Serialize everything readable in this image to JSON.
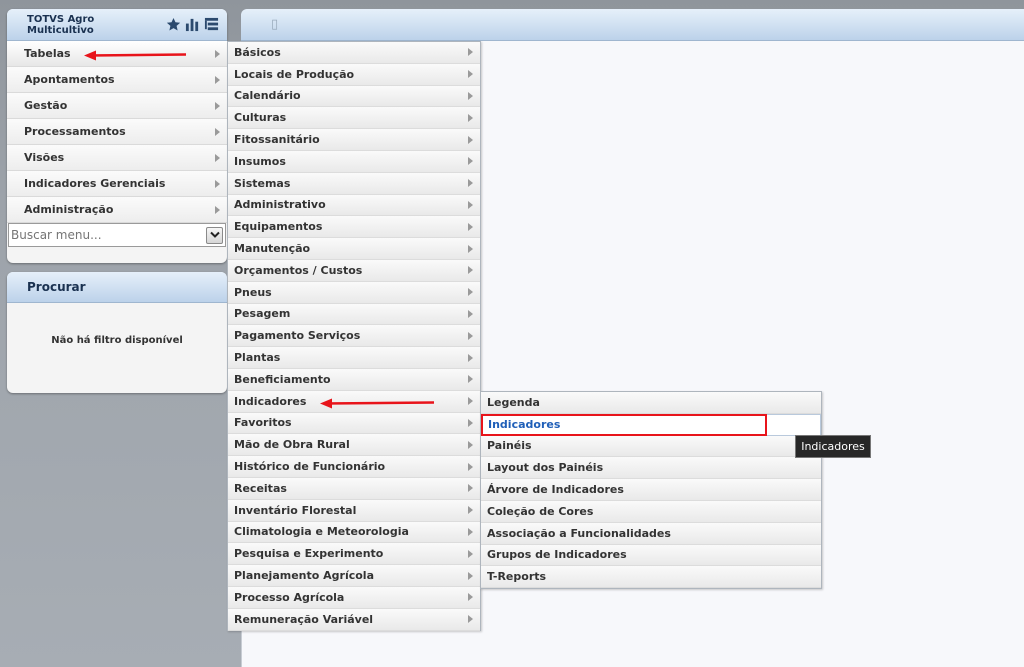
{
  "app": {
    "title": "TOTVS Agro Multicultivo",
    "header_icons": [
      "star-icon",
      "bar-chart-icon",
      "tree-list-icon"
    ]
  },
  "left_menu": {
    "items": [
      {
        "label": "Tabelas"
      },
      {
        "label": "Apontamentos"
      },
      {
        "label": "Gestão"
      },
      {
        "label": "Processamentos"
      },
      {
        "label": "Visões"
      },
      {
        "label": "Indicadores Gerenciais"
      },
      {
        "label": "Administração"
      }
    ],
    "search_placeholder": "Buscar menu..."
  },
  "procurar": {
    "title": "Procurar",
    "empty_message": "Não há filtro disponível"
  },
  "submenu_tabelas": {
    "items": [
      "Básicos",
      "Locais de Produção",
      "Calendário",
      "Culturas",
      "Fitossanitário",
      "Insumos",
      "Sistemas",
      "Administrativo",
      "Equipamentos",
      "Manutenção",
      "Orçamentos / Custos",
      "Pneus",
      "Pesagem",
      "Pagamento Serviços",
      "Plantas",
      "Beneficiamento",
      "Indicadores",
      "Favoritos",
      "Mão de Obra Rural",
      "Histórico de Funcionário",
      "Receitas",
      "Inventário Florestal",
      "Climatologia e Meteorologia",
      "Pesquisa e Experimento",
      "Planejamento Agrícola",
      "Processo Agrícola",
      "Remuneração Variável"
    ]
  },
  "submenu_indicadores": {
    "items": [
      "Legenda",
      "Indicadores",
      "Painéis",
      "Layout dos Painéis",
      "Árvore de Indicadores",
      "Coleção de Cores",
      "Associação a Funcionalidades",
      "Grupos de Indicadores",
      "T-Reports"
    ],
    "hover_index": 1
  },
  "tooltip": {
    "text": "Indicadores"
  },
  "colors": {
    "annotation_red": "#e8141b",
    "hover_text_blue": "#1f5fb8",
    "header_gradient_top": "#e6f0fa",
    "header_gradient_bottom": "#bcd2ea"
  }
}
